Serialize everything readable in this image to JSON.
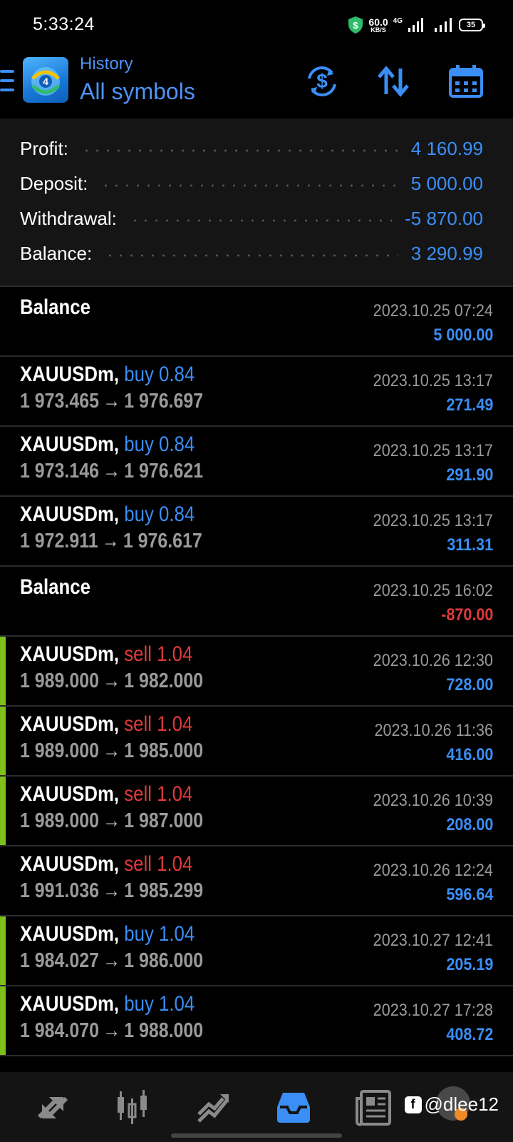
{
  "status_bar": {
    "time": "5:33:24",
    "net_speed_value": "60.0",
    "net_speed_unit": "KB/S",
    "network_type": "4G",
    "battery": "35"
  },
  "header": {
    "subtitle": "History",
    "title": "All symbols"
  },
  "summary": [
    {
      "label": "Profit:",
      "value": "4 160.99"
    },
    {
      "label": "Deposit:",
      "value": "5 000.00"
    },
    {
      "label": "Withdrawal:",
      "value": "-5 870.00"
    },
    {
      "label": "Balance:",
      "value": "3 290.99"
    }
  ],
  "rows": [
    {
      "type": "balance",
      "title": "Balance",
      "time": "2023.10.25 07:24",
      "amount": "5 000.00",
      "negative": false,
      "marker": false
    },
    {
      "type": "trade",
      "symbol": "XAUUSDm,",
      "side": "buy 0.84",
      "open": "1 973.465",
      "close": "1 976.697",
      "time": "2023.10.25 13:17",
      "amount": "271.49",
      "marker": false
    },
    {
      "type": "trade",
      "symbol": "XAUUSDm,",
      "side": "buy 0.84",
      "open": "1 973.146",
      "close": "1 976.621",
      "time": "2023.10.25 13:17",
      "amount": "291.90",
      "marker": false
    },
    {
      "type": "trade",
      "symbol": "XAUUSDm,",
      "side": "buy 0.84",
      "open": "1 972.911",
      "close": "1 976.617",
      "time": "2023.10.25 13:17",
      "amount": "311.31",
      "marker": false
    },
    {
      "type": "balance",
      "title": "Balance",
      "time": "2023.10.25 16:02",
      "amount": "-870.00",
      "negative": true,
      "marker": false
    },
    {
      "type": "trade",
      "symbol": "XAUUSDm,",
      "side": "sell 1.04",
      "open": "1 989.000",
      "close": "1 982.000",
      "time": "2023.10.26 12:30",
      "amount": "728.00",
      "marker": true
    },
    {
      "type": "trade",
      "symbol": "XAUUSDm,",
      "side": "sell 1.04",
      "open": "1 989.000",
      "close": "1 985.000",
      "time": "2023.10.26 11:36",
      "amount": "416.00",
      "marker": true
    },
    {
      "type": "trade",
      "symbol": "XAUUSDm,",
      "side": "sell 1.04",
      "open": "1 989.000",
      "close": "1 987.000",
      "time": "2023.10.26 10:39",
      "amount": "208.00",
      "marker": true
    },
    {
      "type": "trade",
      "symbol": "XAUUSDm,",
      "side": "sell 1.04",
      "open": "1 991.036",
      "close": "1 985.299",
      "time": "2023.10.26 12:24",
      "amount": "596.64",
      "marker": false
    },
    {
      "type": "trade",
      "symbol": "XAUUSDm,",
      "side": "buy 1.04",
      "open": "1 984.027",
      "close": "1 986.000",
      "time": "2023.10.27 12:41",
      "amount": "205.19",
      "marker": true
    },
    {
      "type": "trade",
      "symbol": "XAUUSDm,",
      "side": "buy 1.04",
      "open": "1 984.070",
      "close": "1 988.000",
      "time": "2023.10.27 17:28",
      "amount": "408.72",
      "marker": true
    }
  ],
  "arrow_glyph": "→",
  "watermark": "@dlee12",
  "colors": {
    "accent_blue": "#3a8ef6",
    "sell_red": "#e03a3a",
    "marker_green": "#7fbf1a",
    "background": "#000000"
  },
  "icons": {
    "header": [
      "currency-exchange-icon",
      "sort-icon",
      "calendar-icon"
    ],
    "bottom_nav": [
      "quotes-icon",
      "chart-icon",
      "trade-icon",
      "history-icon",
      "news-icon"
    ]
  }
}
